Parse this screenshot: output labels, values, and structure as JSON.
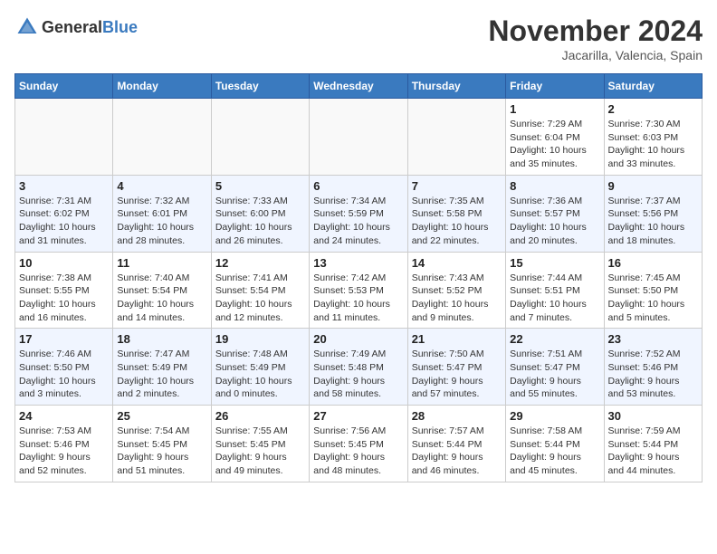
{
  "header": {
    "logo_general": "General",
    "logo_blue": "Blue",
    "month": "November 2024",
    "location": "Jacarilla, Valencia, Spain"
  },
  "weekdays": [
    "Sunday",
    "Monday",
    "Tuesday",
    "Wednesday",
    "Thursday",
    "Friday",
    "Saturday"
  ],
  "weeks": [
    [
      {
        "day": "",
        "info": ""
      },
      {
        "day": "",
        "info": ""
      },
      {
        "day": "",
        "info": ""
      },
      {
        "day": "",
        "info": ""
      },
      {
        "day": "",
        "info": ""
      },
      {
        "day": "1",
        "info": "Sunrise: 7:29 AM\nSunset: 6:04 PM\nDaylight: 10 hours\nand 35 minutes."
      },
      {
        "day": "2",
        "info": "Sunrise: 7:30 AM\nSunset: 6:03 PM\nDaylight: 10 hours\nand 33 minutes."
      }
    ],
    [
      {
        "day": "3",
        "info": "Sunrise: 7:31 AM\nSunset: 6:02 PM\nDaylight: 10 hours\nand 31 minutes."
      },
      {
        "day": "4",
        "info": "Sunrise: 7:32 AM\nSunset: 6:01 PM\nDaylight: 10 hours\nand 28 minutes."
      },
      {
        "day": "5",
        "info": "Sunrise: 7:33 AM\nSunset: 6:00 PM\nDaylight: 10 hours\nand 26 minutes."
      },
      {
        "day": "6",
        "info": "Sunrise: 7:34 AM\nSunset: 5:59 PM\nDaylight: 10 hours\nand 24 minutes."
      },
      {
        "day": "7",
        "info": "Sunrise: 7:35 AM\nSunset: 5:58 PM\nDaylight: 10 hours\nand 22 minutes."
      },
      {
        "day": "8",
        "info": "Sunrise: 7:36 AM\nSunset: 5:57 PM\nDaylight: 10 hours\nand 20 minutes."
      },
      {
        "day": "9",
        "info": "Sunrise: 7:37 AM\nSunset: 5:56 PM\nDaylight: 10 hours\nand 18 minutes."
      }
    ],
    [
      {
        "day": "10",
        "info": "Sunrise: 7:38 AM\nSunset: 5:55 PM\nDaylight: 10 hours\nand 16 minutes."
      },
      {
        "day": "11",
        "info": "Sunrise: 7:40 AM\nSunset: 5:54 PM\nDaylight: 10 hours\nand 14 minutes."
      },
      {
        "day": "12",
        "info": "Sunrise: 7:41 AM\nSunset: 5:54 PM\nDaylight: 10 hours\nand 12 minutes."
      },
      {
        "day": "13",
        "info": "Sunrise: 7:42 AM\nSunset: 5:53 PM\nDaylight: 10 hours\nand 11 minutes."
      },
      {
        "day": "14",
        "info": "Sunrise: 7:43 AM\nSunset: 5:52 PM\nDaylight: 10 hours\nand 9 minutes."
      },
      {
        "day": "15",
        "info": "Sunrise: 7:44 AM\nSunset: 5:51 PM\nDaylight: 10 hours\nand 7 minutes."
      },
      {
        "day": "16",
        "info": "Sunrise: 7:45 AM\nSunset: 5:50 PM\nDaylight: 10 hours\nand 5 minutes."
      }
    ],
    [
      {
        "day": "17",
        "info": "Sunrise: 7:46 AM\nSunset: 5:50 PM\nDaylight: 10 hours\nand 3 minutes."
      },
      {
        "day": "18",
        "info": "Sunrise: 7:47 AM\nSunset: 5:49 PM\nDaylight: 10 hours\nand 2 minutes."
      },
      {
        "day": "19",
        "info": "Sunrise: 7:48 AM\nSunset: 5:49 PM\nDaylight: 10 hours\nand 0 minutes."
      },
      {
        "day": "20",
        "info": "Sunrise: 7:49 AM\nSunset: 5:48 PM\nDaylight: 9 hours\nand 58 minutes."
      },
      {
        "day": "21",
        "info": "Sunrise: 7:50 AM\nSunset: 5:47 PM\nDaylight: 9 hours\nand 57 minutes."
      },
      {
        "day": "22",
        "info": "Sunrise: 7:51 AM\nSunset: 5:47 PM\nDaylight: 9 hours\nand 55 minutes."
      },
      {
        "day": "23",
        "info": "Sunrise: 7:52 AM\nSunset: 5:46 PM\nDaylight: 9 hours\nand 53 minutes."
      }
    ],
    [
      {
        "day": "24",
        "info": "Sunrise: 7:53 AM\nSunset: 5:46 PM\nDaylight: 9 hours\nand 52 minutes."
      },
      {
        "day": "25",
        "info": "Sunrise: 7:54 AM\nSunset: 5:45 PM\nDaylight: 9 hours\nand 51 minutes."
      },
      {
        "day": "26",
        "info": "Sunrise: 7:55 AM\nSunset: 5:45 PM\nDaylight: 9 hours\nand 49 minutes."
      },
      {
        "day": "27",
        "info": "Sunrise: 7:56 AM\nSunset: 5:45 PM\nDaylight: 9 hours\nand 48 minutes."
      },
      {
        "day": "28",
        "info": "Sunrise: 7:57 AM\nSunset: 5:44 PM\nDaylight: 9 hours\nand 46 minutes."
      },
      {
        "day": "29",
        "info": "Sunrise: 7:58 AM\nSunset: 5:44 PM\nDaylight: 9 hours\nand 45 minutes."
      },
      {
        "day": "30",
        "info": "Sunrise: 7:59 AM\nSunset: 5:44 PM\nDaylight: 9 hours\nand 44 minutes."
      }
    ]
  ]
}
